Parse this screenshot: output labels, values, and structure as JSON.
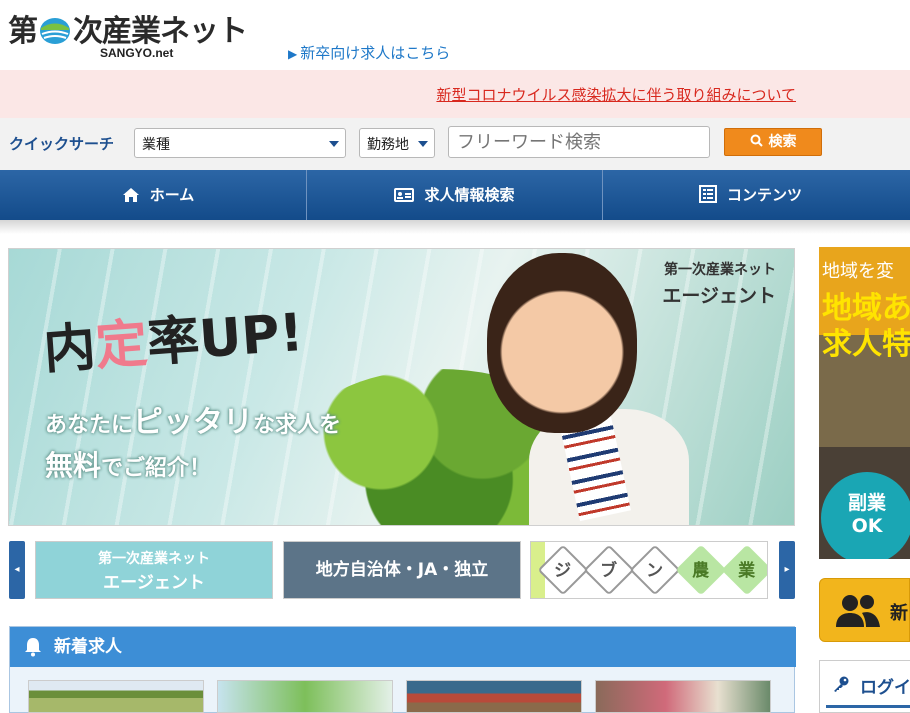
{
  "header": {
    "logo_text": "第一次産業ネット",
    "logo_sub": "SANGYO.net",
    "grad_link": "新卒向け求人はこちら"
  },
  "notice": {
    "text": "新型コロナウイルス感染拡大に伴う取り組みについて"
  },
  "quick_search": {
    "label": "クイックサーチ",
    "industry_value": "業種",
    "area_value": "勤務地",
    "freeword_placeholder": "フリーワード検索",
    "search_label": "検索"
  },
  "nav": {
    "items": [
      {
        "label": "ホーム",
        "icon": "home-icon"
      },
      {
        "label": "求人情報検索",
        "icon": "id-card-icon"
      },
      {
        "label": "コンテンツ",
        "icon": "list-icon"
      }
    ]
  },
  "hero": {
    "brand_line1": "第一次産業ネット",
    "brand_line2": "エージェント",
    "headline_1": "内",
    "headline_pink": "定",
    "headline_2": "率UP!",
    "sub1_pre": "あなたに",
    "sub1_big": "ピッタリ",
    "sub1_post": "な求人を",
    "sub2_big": "無料",
    "sub2_post": "でご紹介！"
  },
  "banners": {
    "agent_line1": "第一次産業ネット",
    "agent_line2": "エージェント",
    "gov": "地方自治体・JA・独立",
    "jibun": [
      "ジ",
      "ブ",
      "ン",
      "農",
      "業"
    ]
  },
  "new_jobs": {
    "title": "新着求人"
  },
  "side": {
    "region_line": "地域を変",
    "region_big": "地域あ\n求人特",
    "side_ok_1": "副業",
    "side_ok_2": "OK",
    "member_text": "新",
    "login_text": "ログイ"
  },
  "colors": {
    "brand_blue": "#1d4f8f",
    "nav_blue": "#2c66a6",
    "notice_red": "#d8281e",
    "search_orange": "#f08a1c",
    "link_blue": "#1e78c8"
  }
}
